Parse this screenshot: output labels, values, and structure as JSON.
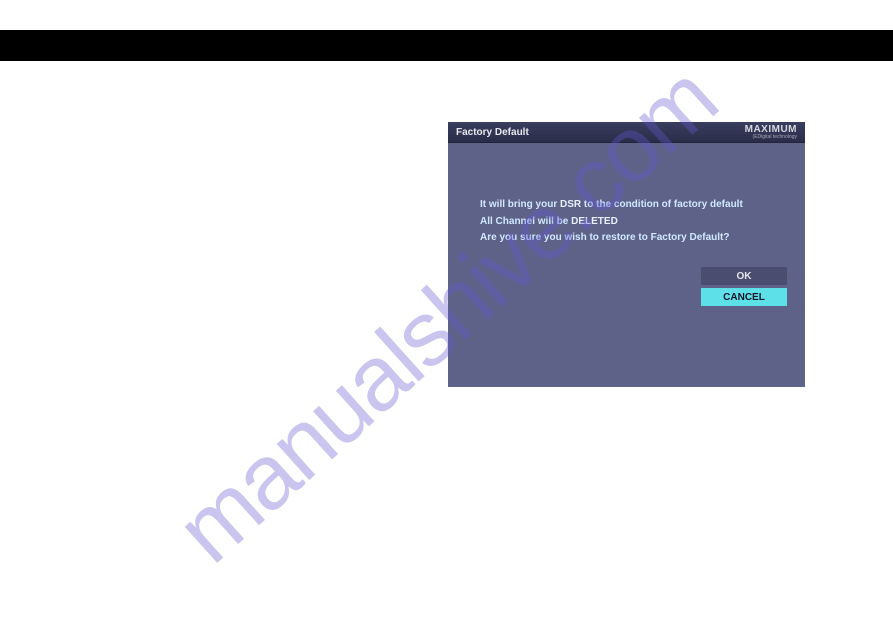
{
  "dialog": {
    "title": "Factory Default",
    "brand": {
      "name": "MAXIMUM",
      "tagline": "(EDigital technology"
    },
    "message": {
      "line1_prefix": "It will bring your ",
      "line1_dsr": "DSR",
      "line1_suffix": " to the condition of factory default",
      "line2_prefix": "All Channel will be ",
      "line2_deleted": "DELETED",
      "line3": "Are you sure you wish to restore to Factory Default?"
    },
    "buttons": {
      "ok": "OK",
      "cancel": "CANCEL"
    }
  },
  "watermark": "manualshive.com"
}
